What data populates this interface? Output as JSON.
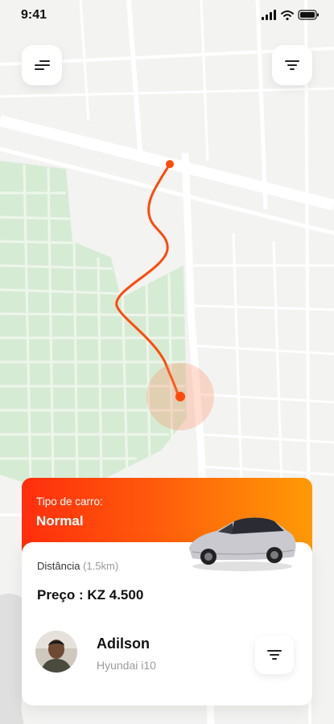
{
  "status_bar": {
    "time": "9:41"
  },
  "top_bar": {
    "menu_icon": "sort-lines-icon",
    "filter_icon": "filter-icon"
  },
  "ride_card": {
    "car_type_label": "Tipo de carro:",
    "car_type": "Normal",
    "distance_label": "Distância",
    "distance_value": "(1.5km)",
    "price_label": "Preço :",
    "price_value": "KZ 4.500",
    "driver_name": "Adilson",
    "driver_car": "Hyundai i10",
    "options_icon": "filter-icon"
  },
  "colors": {
    "accent": "#ff4a0c",
    "gradient_end": "#ff9b05",
    "park_green": "#d4ead3"
  }
}
